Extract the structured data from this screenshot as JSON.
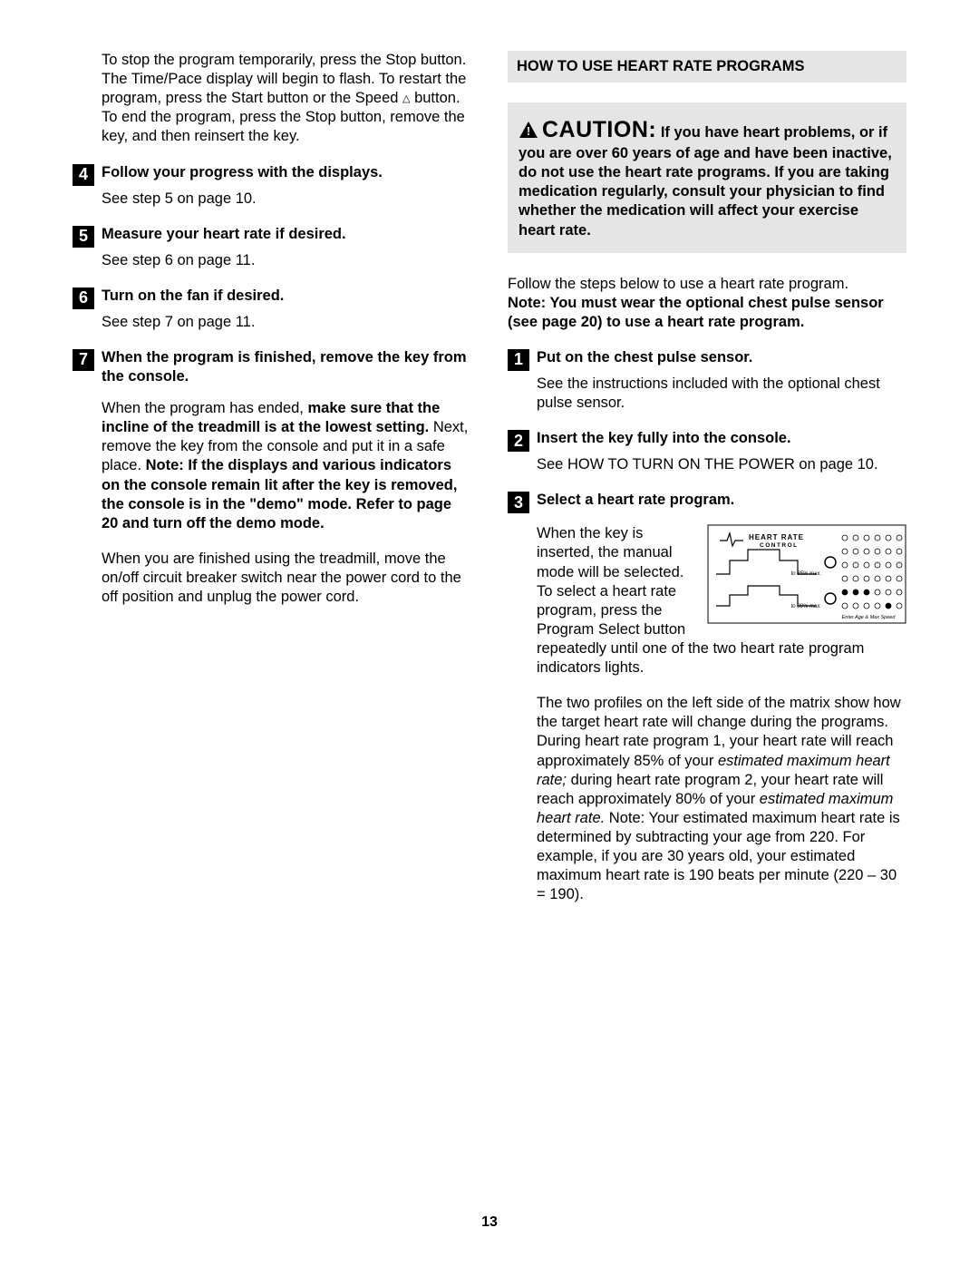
{
  "left": {
    "intro_p1_a": "To stop the program temporarily, press the Stop button. The Time/Pace display will begin to flash. To restart the program, press the Start button or the Speed ",
    "intro_p1_b": " button. To end the program, press the Stop button, remove the key, and then reinsert the key.",
    "steps": [
      {
        "n": "4",
        "title": "Follow your progress with the displays.",
        "body": "See step 5 on page 10."
      },
      {
        "n": "5",
        "title": "Measure your heart rate if desired.",
        "body": "See step 6 on page 11."
      },
      {
        "n": "6",
        "title": "Turn on the fan if desired.",
        "body": "See step 7 on page 11."
      },
      {
        "n": "7",
        "title": "When the program is finished, remove the key from the console."
      }
    ],
    "p7a_pre": "When the program has ended, ",
    "p7a_b1": "make sure that the incline of the treadmill is at the lowest setting.",
    "p7a_mid": " Next, remove the key from the console and put it in a safe place. ",
    "p7a_b2": "Note: If the displays and various indicators on the console remain lit after the key is removed, the console is in the \"demo\" mode. Refer to page 20 and turn off the demo mode.",
    "p7b": "When you are finished using the treadmill, move the on/off circuit breaker switch near the power cord to the off position and unplug the power cord."
  },
  "right": {
    "hdr": "HOW TO USE HEART RATE PROGRAMS",
    "caution_word": "CAUTION:",
    "caution_body": "If you have heart problems, or if you are over 60 years of age and have been inactive, do not use the heart rate programs. If you are taking medication regularly, consult your physician to find whether the medication will affect your exercise heart rate.",
    "intro_line": "Follow the steps below to use a heart rate program.",
    "intro_bold": "Note: You must wear the optional chest pulse sensor (see page 20) to use a heart rate program.",
    "s1_n": "1",
    "s1_title": "Put on the chest pulse sensor.",
    "s1_body": "See the instructions included with the optional chest pulse sensor.",
    "s2_n": "2",
    "s2_title": "Insert the key fully into the console.",
    "s2_body": "See HOW TO TURN ON THE POWER on page 10.",
    "s3_n": "3",
    "s3_title": "Select a heart rate program.",
    "s3_p1": "When the key is inserted, the manual mode will be selected. To select a heart rate program, press the Program Select button repeatedly until one of the two heart rate program indicators lights.",
    "s3_p2a": "The two profiles on the left side of the matrix show how the target heart rate will change during the programs. During heart rate program 1, your heart rate will reach approximately 85% of your ",
    "s3_p2_it1": "estimated maximum heart rate;",
    "s3_p2b": " during heart rate program 2, your heart rate will reach approximately 80% of your ",
    "s3_p2_it2": "estimated maximum heart rate.",
    "s3_p2c": " Note: Your estimated maximum heart rate is determined by subtracting your age from 220. For example, if you are 30 years old, your estimated maximum heart rate is 190 beats per minute (220 – 30 = 190).",
    "graphic": {
      "label_top": "HEART RATE",
      "label_sub": "CONTROL",
      "t85": "to 85% max.",
      "t80": "to 80% max.",
      "enter": "Enter Age & Max Speed"
    }
  },
  "pagenum": "13"
}
